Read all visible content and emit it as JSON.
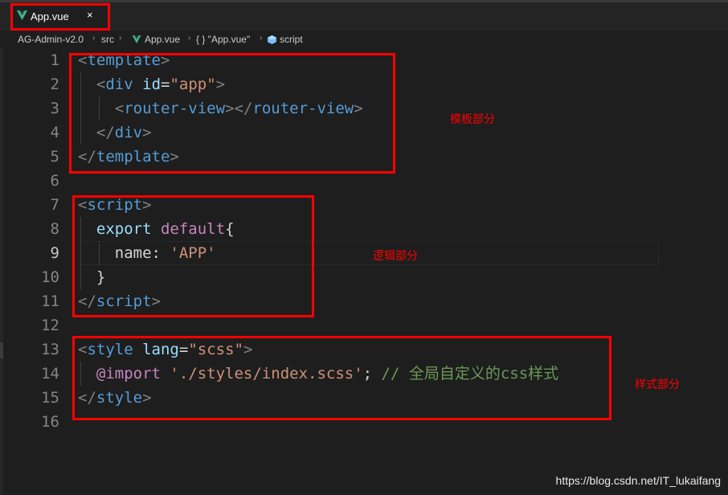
{
  "tab": {
    "label": "App.vue",
    "close": "×"
  },
  "breadcrumb": {
    "items": [
      "AG-Admin-v2.0",
      "src",
      "App.vue",
      "{ } \"App.vue\"",
      "script"
    ],
    "separator": "›"
  },
  "editor": {
    "line_numbers": [
      "1",
      "2",
      "3",
      "4",
      "5",
      "6",
      "7",
      "8",
      "9",
      "10",
      "11",
      "12",
      "13",
      "14",
      "15",
      "16"
    ],
    "current_line": "9",
    "lines": [
      [
        [
          "p",
          "<"
        ],
        [
          "t",
          "template"
        ],
        [
          "p",
          ">"
        ]
      ],
      [
        [
          "x",
          "  "
        ],
        [
          "p",
          "<"
        ],
        [
          "t",
          "div"
        ],
        [
          "x",
          " "
        ],
        [
          "a",
          "id"
        ],
        [
          "x",
          "="
        ],
        [
          "s",
          "\"app\""
        ],
        [
          "p",
          ">"
        ]
      ],
      [
        [
          "x",
          "    "
        ],
        [
          "p",
          "<"
        ],
        [
          "t",
          "router-view"
        ],
        [
          "p",
          "></"
        ],
        [
          "t",
          "router-view"
        ],
        [
          "p",
          ">"
        ]
      ],
      [
        [
          "x",
          "  "
        ],
        [
          "p",
          "</"
        ],
        [
          "t",
          "div"
        ],
        [
          "p",
          ">"
        ]
      ],
      [
        [
          "p",
          "</"
        ],
        [
          "t",
          "template"
        ],
        [
          "p",
          ">"
        ]
      ],
      [],
      [
        [
          "p",
          "<"
        ],
        [
          "t",
          "script"
        ],
        [
          "p",
          ">"
        ]
      ],
      [
        [
          "x",
          "  "
        ],
        [
          "a",
          "export"
        ],
        [
          "x",
          " "
        ],
        [
          "k",
          "default"
        ],
        [
          "x",
          "{"
        ]
      ],
      [
        [
          "x",
          "    "
        ],
        [
          "x",
          "name"
        ],
        [
          "x",
          ": "
        ],
        [
          "s",
          "'APP'"
        ]
      ],
      [
        [
          "x",
          "  }"
        ]
      ],
      [
        [
          "p",
          "</"
        ],
        [
          "t",
          "script"
        ],
        [
          "p",
          ">"
        ]
      ],
      [],
      [
        [
          "p",
          "<"
        ],
        [
          "t",
          "style"
        ],
        [
          "x",
          " "
        ],
        [
          "a",
          "lang"
        ],
        [
          "x",
          "="
        ],
        [
          "s",
          "\"scss\""
        ],
        [
          "p",
          ">"
        ]
      ],
      [
        [
          "x",
          "  "
        ],
        [
          "k",
          "@import"
        ],
        [
          "x",
          " "
        ],
        [
          "s",
          "'./styles/index.scss'"
        ],
        [
          "x",
          "; "
        ],
        [
          "c",
          "// 全局自定义的css样式"
        ]
      ],
      [
        [
          "p",
          "</"
        ],
        [
          "t",
          "style"
        ],
        [
          "p",
          ">"
        ]
      ],
      []
    ]
  },
  "annotations": {
    "template": "模板部分",
    "logic": "逻辑部分",
    "style": "样式部分"
  },
  "watermark": "https://blog.csdn.net/IT_lukaifang",
  "colors": {
    "background": "#1e1e1e",
    "highlight_box": "#ff0000",
    "tag": "#569cd6",
    "punctuation": "#808080",
    "attribute": "#9cdcfe",
    "string": "#ce9178",
    "keyword": "#c586c0",
    "comment": "#6a9955",
    "vue_green": "#41b883"
  }
}
